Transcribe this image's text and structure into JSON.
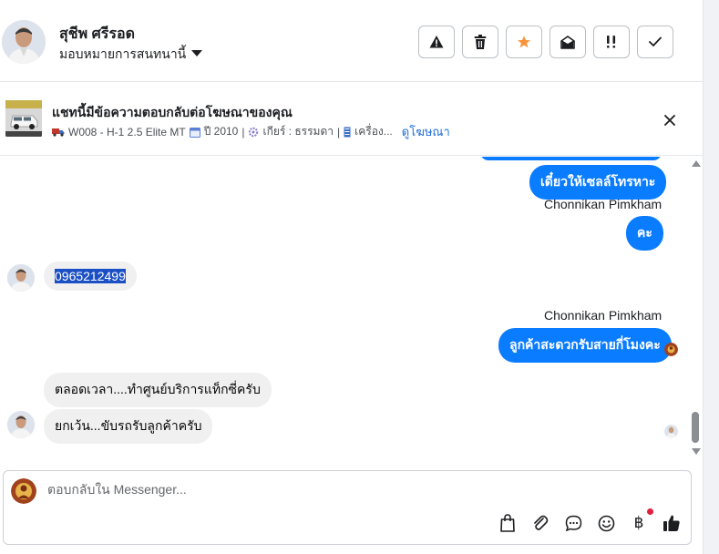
{
  "header": {
    "contact_name": "สุชีพ ศรีรอด",
    "assign_label": "มอบหมายการสนทนานี้",
    "toolbar": [
      {
        "icon": "warning-icon",
        "action": "report"
      },
      {
        "icon": "trash-icon",
        "action": "delete"
      },
      {
        "icon": "star-icon",
        "action": "star"
      },
      {
        "icon": "mail-open-icon",
        "action": "mark-unread"
      },
      {
        "icon": "follow-up-icon",
        "action": "follow-up"
      },
      {
        "icon": "check-icon",
        "action": "done"
      }
    ]
  },
  "ad_banner": {
    "title": "แชทนี้มีข้อความตอบกลับต่อโฆษณาของคุณ",
    "listing": "W008 - H-1 2.5 Elite MT",
    "year": "ปี 2010",
    "gear": "เกียร์ : ธรรมดา",
    "engine": "เครื่อง...",
    "view_ad": "ดูโฆษณา"
  },
  "thread": {
    "out_1": "เดี๋ยวให้เซลล์โทรหาะ",
    "sender_1": "Chonnikan Pimkham",
    "out_2": "คะ",
    "in_1": "0965212499",
    "sender_2": "Chonnikan Pimkham",
    "out_3": "ลูกค้าสะดวกรับสายกี่โมงคะ",
    "in_2": "ตลอดเวลา....ทำศูนย์บริการแท็กซี่ครับ",
    "in_3": "ยกเว้น...ขับรถรับลูกค้าครับ"
  },
  "composer": {
    "placeholder": "ตอบกลับใน Messenger..."
  },
  "colors": {
    "accent": "#0a7cff",
    "star": "#f7923b",
    "link": "#216fdb",
    "notify": "#e41e3f"
  }
}
